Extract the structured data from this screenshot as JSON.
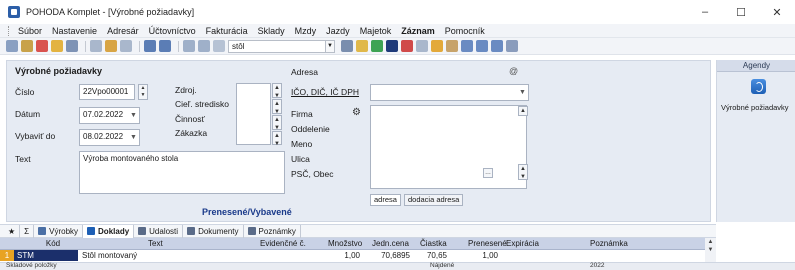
{
  "window": {
    "title": "POHODA Komplet - [Výrobné požiadavky]",
    "controls": [
      "–",
      "☐",
      "✕"
    ]
  },
  "menu": [
    {
      "label": "Súbor",
      "active": false
    },
    {
      "label": "Nastavenie",
      "active": false
    },
    {
      "label": "Adresár",
      "active": false
    },
    {
      "label": "Účtovníctvo",
      "active": false
    },
    {
      "label": "Fakturácia",
      "active": false
    },
    {
      "label": "Sklady",
      "active": false
    },
    {
      "label": "Mzdy",
      "active": false
    },
    {
      "label": "Jazdy",
      "active": false
    },
    {
      "label": "Majetok",
      "active": false
    },
    {
      "label": "Záznam",
      "active": true
    },
    {
      "label": "Pomocník",
      "active": false
    }
  ],
  "toolbar": {
    "search_value": "stôl"
  },
  "form": {
    "section_title": "Výrobné požiadavky",
    "cislo_label": "Číslo",
    "cislo_value": "22Vpo00001",
    "datum_label": "Dátum",
    "datum_value": "07.02.2022",
    "vybavit_label": "Vybaviť do",
    "vybavit_value": "08.02.2022",
    "text_label": "Text",
    "text_value": "Výroba montovaného stola",
    "zdroj_label": "Zdroj.",
    "ciel_label": "Cieľ. stredisko",
    "cinnost_label": "Činnosť",
    "zakazka_label": "Zákazka",
    "footer_label": "Prenesené/Vybavené"
  },
  "address": {
    "section_title": "Adresa",
    "ico_label": "IČO, DIČ, IČ DPH",
    "firma_label": "Firma",
    "oddelenie_label": "Oddelenie",
    "meno_label": "Meno",
    "ulica_label": "Ulica",
    "psc_label": "PSČ, Obec",
    "tab_adresa": "adresa",
    "tab_dodacia": "dodacia adresa"
  },
  "agendy": {
    "title": "Agendy",
    "item_label": "Výrobné požiadavky"
  },
  "tabs": [
    {
      "label": "Výrobky",
      "icon_color": "#4a6fa5",
      "active": false
    },
    {
      "label": "Doklady",
      "icon_color": "#1d5fb5",
      "active": true
    },
    {
      "label": "Udalosti",
      "icon_color": "#5a6b88",
      "active": false
    },
    {
      "label": "Dokumenty",
      "icon_color": "#5a6b88",
      "active": false
    },
    {
      "label": "Poznámky",
      "icon_color": "#5a6b88",
      "active": false
    }
  ],
  "grid": {
    "headers": [
      "Kód",
      "Text",
      "Evidenčné č.",
      "Množstvo",
      "Jedn.cena",
      "Čiastka",
      "Prenesené",
      "Expirácia",
      "Poznámka"
    ],
    "rows": [
      {
        "num": "1",
        "kod": "STM",
        "text": "Stôl montovaný",
        "evid": "",
        "mnozstvo": "1,00",
        "jedncena": "70,6895",
        "ciastka": "70,65",
        "prenesene": "1,00",
        "expiracia": "",
        "poznamka": ""
      }
    ]
  },
  "status": {
    "left": "Skladové položky",
    "mid": "Nájdené",
    "year": "2022"
  },
  "colors": {
    "accent_blue": "#1d5fb5",
    "row_highlight": "#e8a323",
    "kod_cell": "#1b2f6b"
  }
}
